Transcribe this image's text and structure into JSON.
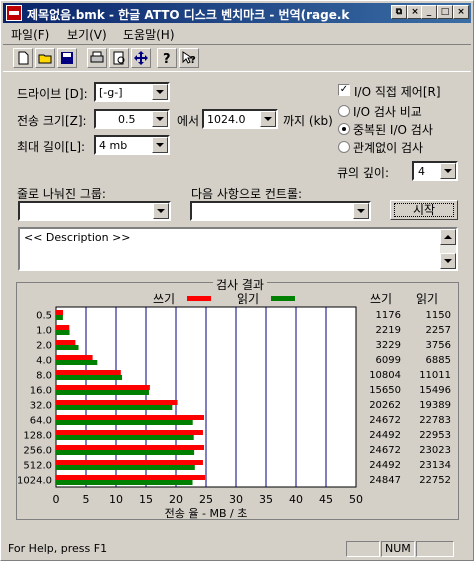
{
  "window": {
    "title": "제목없음.bmk - 한글 ATTO 디스크 벤치마크 - 번역(rage.k"
  },
  "menu": [
    "파일(F)",
    "보기(V)",
    "도움말(H)"
  ],
  "toolbar_icons": [
    "new-file-icon",
    "open-folder-icon",
    "save-icon",
    "print-icon",
    "print-preview-icon",
    "move-icon",
    "help-icon",
    "context-help-icon"
  ],
  "form": {
    "drive_label": "드라이브 [D]:",
    "drive_value": "[-g-]",
    "transfer_label": "전송 크기[Z]:",
    "transfer_from": "0.5",
    "from_suffix": "에서",
    "transfer_to": "1024.0",
    "to_suffix": "까지 (kb)",
    "max_length_label": "최대 길이[L]:",
    "max_length_value": "4 mb",
    "direct_io_label": "I/O 직접 제어[R]",
    "direct_io_checked": "✓",
    "radio_compare": "I/O 검사 비교",
    "radio_overlap": "중복된 I/O 검사",
    "radio_neither": "관계없이 검사",
    "queue_label": "큐의 깊이:",
    "queue_value": "4",
    "split_group_label": "줄로 나눠진 그룹:",
    "control_label": "다음 사항으로 컨트롤:",
    "start_button": "시작",
    "description": "<< Description >>"
  },
  "results": {
    "title": "검사 결과",
    "write_label": "쓰기",
    "read_label": "읽기",
    "write_color": "#ff0000",
    "read_color": "#008000",
    "col_write": "쓰기",
    "col_read": "읽기"
  },
  "chart_data": {
    "type": "bar",
    "orientation": "horizontal",
    "title": "검사 결과",
    "xlabel": "전송 율 - MB / 초",
    "xlim": [
      0,
      50
    ],
    "xticks": [
      "0",
      "5",
      "10",
      "15",
      "20",
      "25",
      "30",
      "35",
      "40",
      "45",
      "50"
    ],
    "categories": [
      "0.5",
      "1.0",
      "2.0",
      "4.0",
      "8.0",
      "16.0",
      "32.0",
      "64.0",
      "128.0",
      "256.0",
      "512.0",
      "1024.0"
    ],
    "series": [
      {
        "name": "쓰기",
        "values": [
          1.176,
          2.219,
          3.229,
          6.099,
          10.804,
          15.65,
          20.262,
          24.672,
          24.492,
          24.672,
          24.492,
          24.847
        ]
      },
      {
        "name": "읽기",
        "values": [
          1.15,
          2.257,
          3.756,
          6.885,
          11.011,
          15.496,
          19.389,
          22.783,
          22.953,
          23.023,
          23.134,
          22.752
        ]
      }
    ],
    "write_numbers": [
      "1176",
      "2219",
      "3229",
      "6099",
      "10804",
      "15650",
      "20262",
      "24672",
      "24492",
      "24672",
      "24492",
      "24847"
    ],
    "read_numbers": [
      "1150",
      "2257",
      "3756",
      "6885",
      "11011",
      "15496",
      "19389",
      "22783",
      "22953",
      "23023",
      "23134",
      "22752"
    ]
  },
  "status": {
    "help": "For Help, press F1",
    "num": "NUM"
  }
}
